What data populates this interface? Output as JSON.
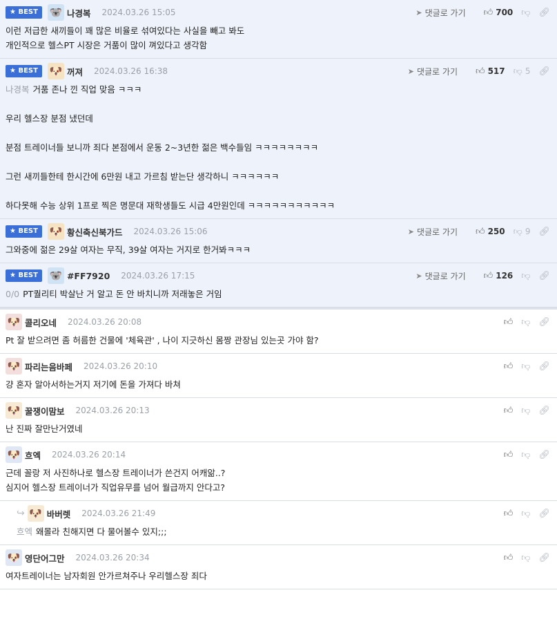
{
  "labels": {
    "best": "BEST",
    "goto_reply": "댓글로 가기",
    "like_icon": "thumbs-up-icon",
    "dislike_icon": "thumbs-down-icon",
    "link_icon": "link-icon"
  },
  "colors": {
    "best_badge": "#3b6fd8",
    "best_background": "#eef2fa"
  },
  "best_comments": [
    {
      "nick": "나경복",
      "date": "2024.03.26 15:05",
      "likes": "700",
      "dislikes": "",
      "mention": "",
      "lines": [
        "이런 저급한 새끼들이 꽤 많은 비율로 섞여있다는 사실을 빼고 봐도",
        "개인적으로 헬스PT 시장은 거품이 많이 껴있다고 생각함"
      ]
    },
    {
      "nick": "꺼져",
      "date": "2024.03.26 16:38",
      "likes": "517",
      "dislikes": "5",
      "mention": "나경복",
      "lines": [
        "거품 존나 낀 직업 맞음 ㅋㅋㅋ",
        "",
        "우리 헬스장 분점 냈던데",
        "",
        "분점 트레이너들 보니까 죄다 본점에서 운동 2~3년한 젊은 백수들임 ㅋㅋㅋㅋㅋㅋㅋㅋ",
        "",
        "그런 새끼들한테 한시간에 6만원 내고 가르침 받는단 생각하니 ㅋㅋㅋㅋㅋㅋ",
        "",
        "하다못해 수능 상위 1프로 찍은 명문대 재학생들도 시급 4만원인데 ㅋㅋㅋㅋㅋㅋㅋㅋㅋㅋㅋ"
      ]
    },
    {
      "nick": "황신축신북가드",
      "date": "2024.03.26 15:06",
      "likes": "250",
      "dislikes": "9",
      "mention": "",
      "lines": [
        "그와중에 젊은 29살 여자는 무직, 39살 여자는 거지로 한거봐ㅋㅋㅋ"
      ]
    },
    {
      "nick": "#FF7920",
      "date": "2024.03.26 17:15",
      "likes": "126",
      "dislikes": "",
      "mention": "0/0",
      "lines": [
        "PT퀄리티 박살난 거 알고 돈 안 바치니까 저래놓은 거임"
      ]
    }
  ],
  "comments": [
    {
      "nick": "콜리오네",
      "date": "2024.03.26 20:08",
      "reply": false,
      "mention": "",
      "lines": [
        "Pt 잘 받으려면 좀 허름한 건물에 '체육관' , 나이 지긋하신 몸짱 관장님 있는곳 가야 함?"
      ]
    },
    {
      "nick": "파리는음바페",
      "date": "2024.03.26 20:10",
      "reply": false,
      "mention": "",
      "lines": [
        "걍 혼자 알아서하는거지 저기에 돈을 가져다 바쳐"
      ]
    },
    {
      "nick": "꿀쟁이맘보",
      "date": "2024.03.26 20:13",
      "reply": false,
      "mention": "",
      "lines": [
        "난 진짜 잘만난거였네"
      ]
    },
    {
      "nick": "흐엑",
      "date": "2024.03.26 20:14",
      "reply": false,
      "mention": "",
      "lines": [
        "근데 꼴랑 저 사진하나로 헬스장 트레이너가 쓴건지 어캐앎..?",
        "심지어 헬스장 트레이너가 직업유무를 넘어 월급까지 안다고?"
      ]
    },
    {
      "nick": "바버렛",
      "date": "2024.03.26 21:49",
      "reply": true,
      "mention": "흐엑",
      "lines": [
        "왜몰라 친해지면 다 물어볼수 있지;;;"
      ]
    },
    {
      "nick": "영단어그만",
      "date": "2024.03.26 20:34",
      "reply": false,
      "mention": "",
      "lines": [
        "여자트레이너는 남자회원 안가르쳐주나 우리헬스장 죄다"
      ]
    }
  ]
}
